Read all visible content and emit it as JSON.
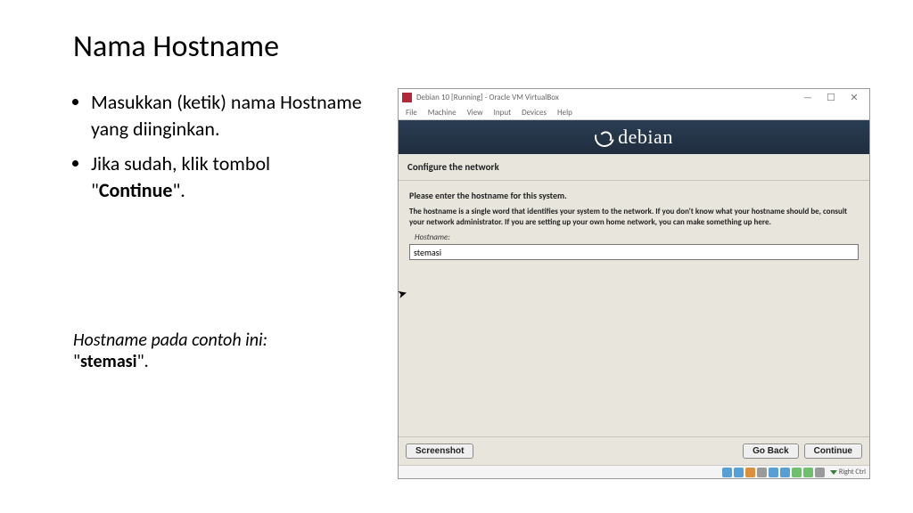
{
  "slide": {
    "title": "Nama Hostname",
    "bullets": [
      {
        "pre": "Masukkan (ketik) nama Hostname yang diinginkan.",
        "bold": "",
        "post": ""
      },
      {
        "pre": "Jika sudah, klik tombol \"",
        "bold": "Continue",
        "post": "\"."
      }
    ],
    "note_line1": "Hostname pada contoh ini:",
    "note_quote_open": "\"",
    "note_bold": "stemasi",
    "note_quote_close": "\"."
  },
  "vb": {
    "title": "Debian 10 [Running] - Oracle VM VirtualBox",
    "menu": [
      "File",
      "Machine",
      "View",
      "Input",
      "Devices",
      "Help"
    ],
    "win_min": "—",
    "win_max": "☐",
    "win_close": "✕",
    "hostkey": "Right Ctrl"
  },
  "guest": {
    "brand": "debian",
    "section": "Configure the network",
    "prompt": "Please enter the hostname for this system.",
    "desc": "The hostname is a single word that identifies your system to the network. If you don't know what your hostname should be, consult your network administrator. If you are setting up your own home network, you can make something up here.",
    "field_label": "Hostname:",
    "field_value": "stemasi",
    "btn_screenshot": "Screenshot",
    "btn_back": "Go Back",
    "btn_continue": "Continue"
  }
}
